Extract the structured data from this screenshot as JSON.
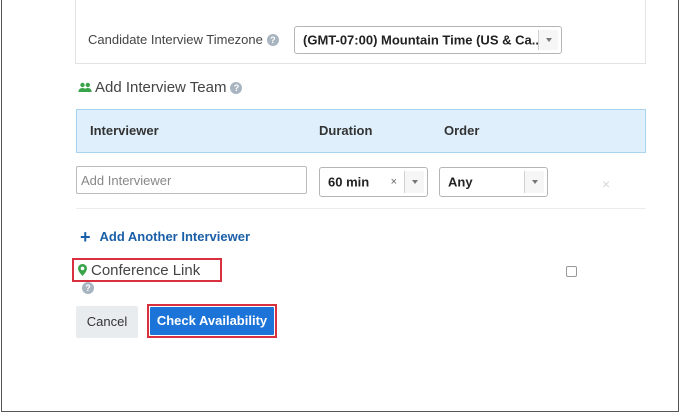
{
  "timezone": {
    "label": "Candidate Interview Timezone",
    "help_icon": "question-circle-icon",
    "selected": "(GMT-07:00) Mountain Time (US & Ca..."
  },
  "team": {
    "title": "Add Interview Team",
    "icon": "users-icon",
    "icon_color": "#3aa44a",
    "columns": [
      "Interviewer",
      "Duration",
      "Order"
    ],
    "interviewer_placeholder": "Add Interviewer",
    "duration_selected": "60 min",
    "duration_clear": "×",
    "order_selected": "Any",
    "row_remove": "×"
  },
  "add_another": {
    "plus": "+",
    "label": "Add Another Interviewer"
  },
  "conference": {
    "label": "Conference Link",
    "icon": "map-pin-icon",
    "icon_color": "#3aa44a"
  },
  "buttons": {
    "cancel": "Cancel",
    "check": "Check Availability"
  },
  "colors": {
    "primary": "#1d74d8",
    "header_bg": "#dff0fc",
    "highlight": "#d9303f"
  }
}
